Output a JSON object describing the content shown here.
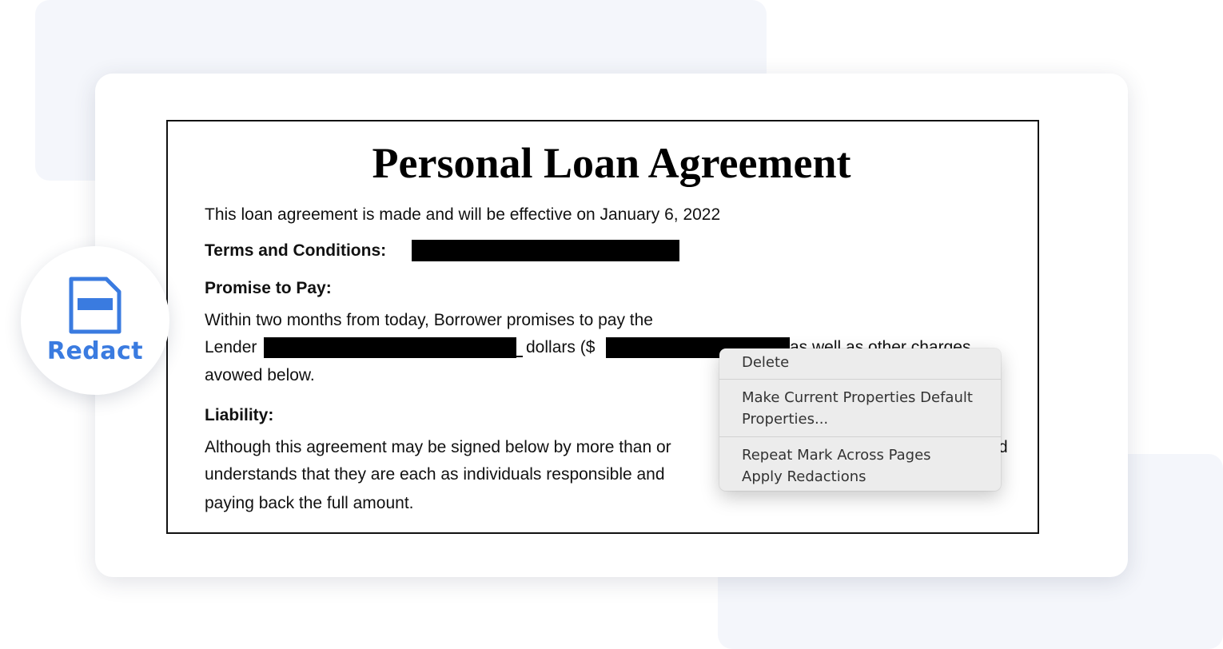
{
  "badge": {
    "label": "Redact",
    "icon": "redact-icon",
    "color": "#3a7be0"
  },
  "document": {
    "title": "Personal Loan Agreement",
    "effective_line": "This loan agreement is made and will be effective on January 6, 2022",
    "terms_label": "Terms and Conditions:",
    "promise_heading": "Promise to Pay:",
    "promise_line1": "Within two months from today, Borrower promises to pay the",
    "promise_line2_lender": "Lender",
    "promise_line2_dollars": "dollars ($",
    "promise_line2_tail": "as well as other charges",
    "promise_line3": "avowed below.",
    "liability_heading": "Liability:",
    "liability_line1_start": "Although this agreement may be signed below by more than or",
    "liability_line1_end": "d",
    "liability_line2_start": "understands that they are each as individuals responsible and",
    "liability_line3": "paying back the full amount."
  },
  "context_menu": {
    "items": [
      "Delete",
      "Make Current Properties Default",
      "Properties...",
      "Repeat Mark Across Pages",
      "Apply Redactions"
    ]
  }
}
